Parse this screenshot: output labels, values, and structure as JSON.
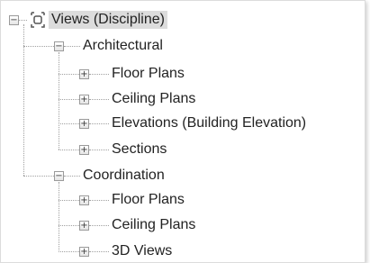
{
  "tree": {
    "root": {
      "label": "Views (Discipline)",
      "icon": "views-icon",
      "expanded": true
    },
    "groups": [
      {
        "label": "Architectural",
        "expanded": true,
        "items": [
          {
            "label": "Floor Plans",
            "expanded": false
          },
          {
            "label": "Ceiling Plans",
            "expanded": false
          },
          {
            "label": "Elevations (Building Elevation)",
            "expanded": false
          },
          {
            "label": "Sections",
            "expanded": false
          }
        ]
      },
      {
        "label": "Coordination",
        "expanded": true,
        "items": [
          {
            "label": "Floor Plans",
            "expanded": false
          },
          {
            "label": "Ceiling Plans",
            "expanded": false
          },
          {
            "label": "3D Views",
            "expanded": false
          }
        ]
      }
    ],
    "toggle_glyphs": {
      "expanded": "−",
      "collapsed": "+"
    },
    "colors": {
      "selection": "#dcdcdc",
      "lines": "#a0a0a0",
      "text": "#222222"
    }
  }
}
